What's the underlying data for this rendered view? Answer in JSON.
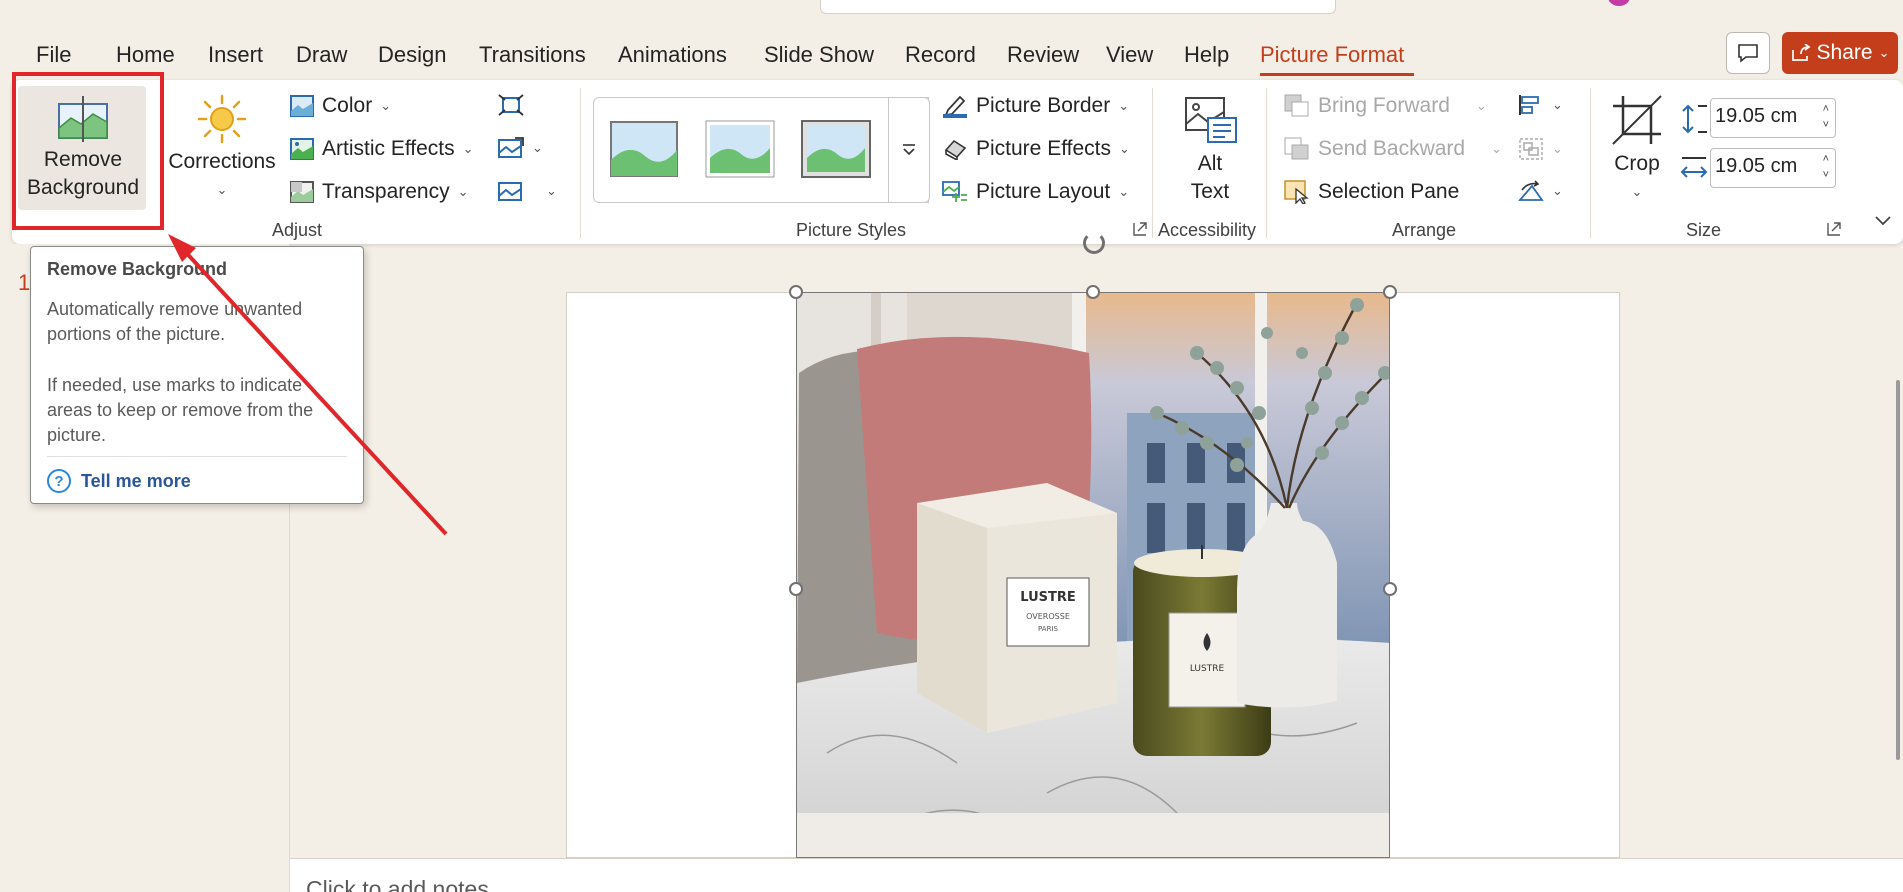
{
  "tabs": [
    {
      "label": "File"
    },
    {
      "label": "Home"
    },
    {
      "label": "Insert"
    },
    {
      "label": "Draw"
    },
    {
      "label": "Design"
    },
    {
      "label": "Transitions"
    },
    {
      "label": "Animations"
    },
    {
      "label": "Slide Show"
    },
    {
      "label": "Record"
    },
    {
      "label": "Review"
    },
    {
      "label": "View"
    },
    {
      "label": "Help"
    },
    {
      "label": "Picture Format"
    }
  ],
  "active_tab": "Picture Format",
  "share_label": "Share",
  "ribbon": {
    "adjust": {
      "remove_bg_line1": "Remove",
      "remove_bg_line2": "Background",
      "corrections": "Corrections",
      "color": "Color",
      "artistic": "Artistic Effects",
      "transparency": "Transparency",
      "label": "Adjust"
    },
    "styles": {
      "border": "Picture Border",
      "effects": "Picture Effects",
      "layout": "Picture Layout",
      "label": "Picture Styles"
    },
    "accessibility": {
      "alt1": "Alt",
      "alt2": "Text",
      "label": "Accessibility"
    },
    "arrange": {
      "forward": "Bring Forward",
      "backward": "Send Backward",
      "selection": "Selection Pane",
      "label": "Arrange"
    },
    "size": {
      "crop": "Crop",
      "height": "19.05 cm",
      "width": "19.05 cm",
      "label": "Size"
    }
  },
  "tooltip": {
    "title": "Remove Background",
    "body1": "Automatically remove unwanted portions of the picture.",
    "body2": "If needed, use marks to indicate areas to keep or remove from the picture.",
    "link": "Tell me more"
  },
  "slide_number": "1",
  "picture_texts": {
    "box_brand": "LUSTRE",
    "box_line2": "OVEROSSE",
    "box_line3": "PARIS",
    "jar_brand": "LUSTRE"
  },
  "notes_placeholder": "Click to add notes",
  "colors": {
    "accent": "#c43e1c",
    "highlight": "#e0262a"
  }
}
